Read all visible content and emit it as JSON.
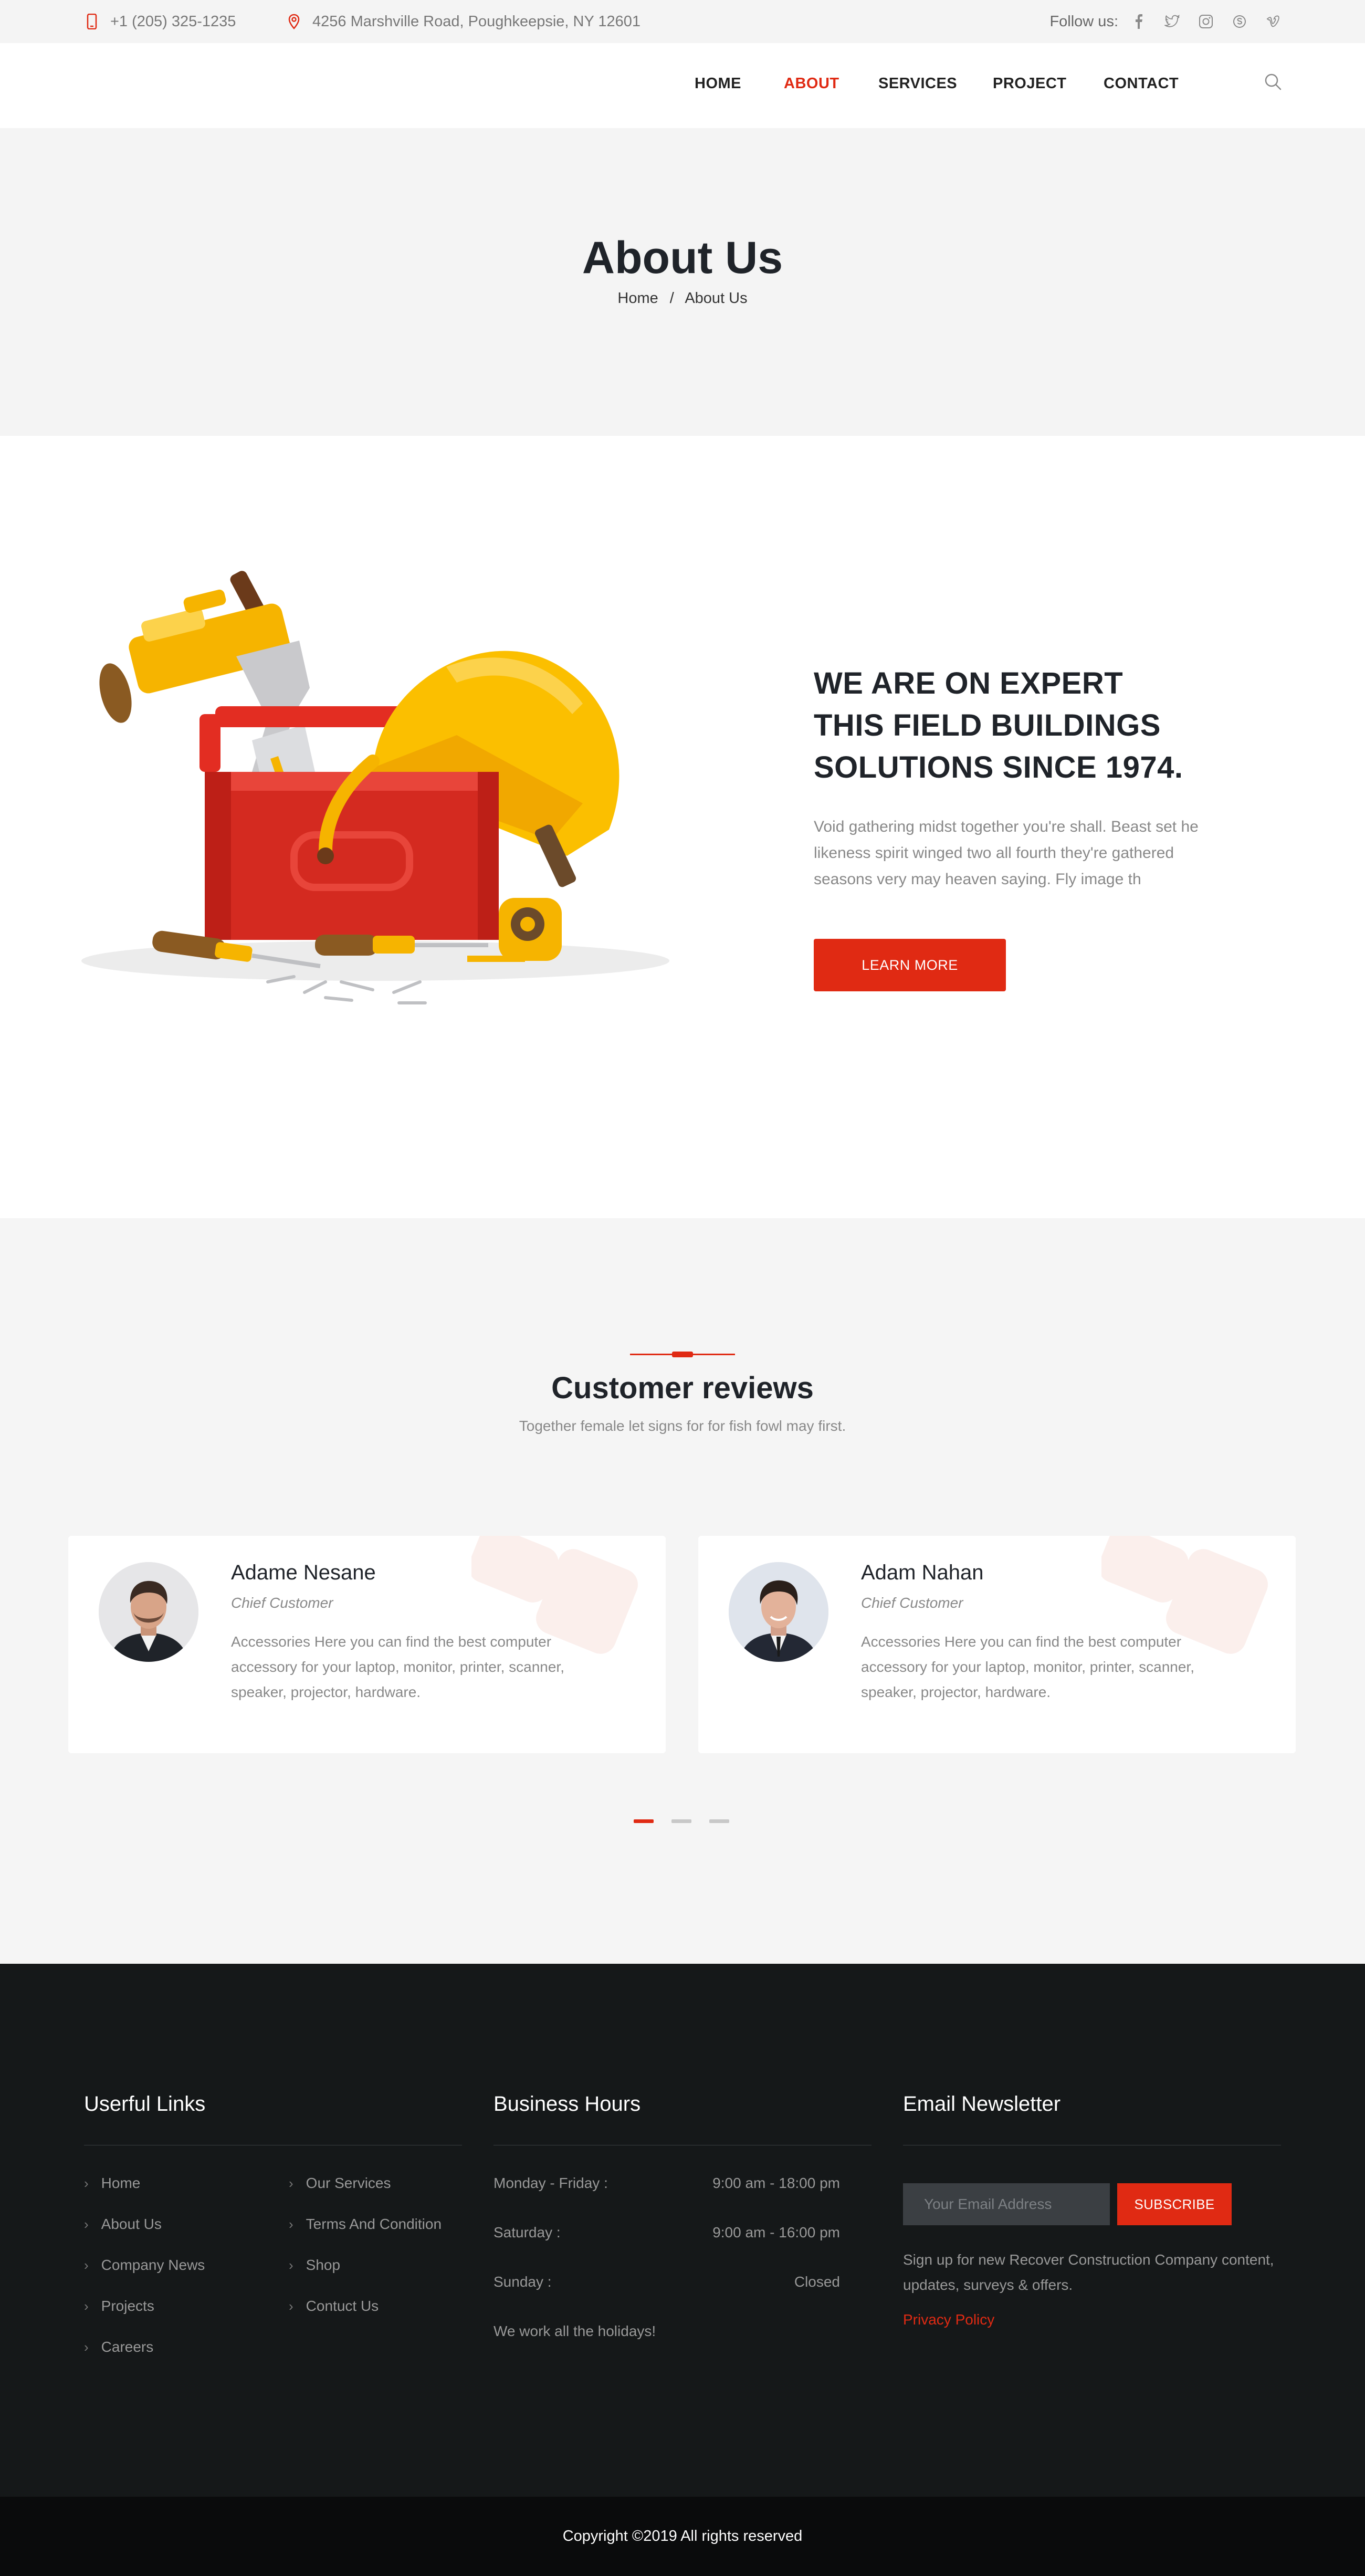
{
  "topbar": {
    "phone": "+1 (205) 325-1235",
    "address": "4256 Marshville Road, Poughkeepsie, NY 12601",
    "follow_label": "Follow us:",
    "social_icons": [
      "facebook-icon",
      "twitter-icon",
      "instagram-icon",
      "skype-icon",
      "vimeo-icon"
    ],
    "icons": {
      "phone": "mobile-phone-icon",
      "address": "map-pin-icon"
    }
  },
  "nav": {
    "items": [
      {
        "label": "HOME",
        "active": false
      },
      {
        "label": "ABOUT",
        "active": true
      },
      {
        "label": "SERVICES",
        "active": false
      },
      {
        "label": "PROJECT",
        "active": false
      },
      {
        "label": "CONTACT",
        "active": false
      }
    ],
    "search_icon": "search-icon"
  },
  "hero": {
    "title": "About Us",
    "breadcrumb": {
      "home": "Home",
      "separator": "/",
      "current": "About Us"
    }
  },
  "about": {
    "title_lines": [
      "WE ARE ON EXPERT",
      "THIS FIELD BUILDINGS",
      "SOLUTIONS SINCE 1974."
    ],
    "text": "Void gathering midst together you're shall. Beast set he likeness spirit winged two all fourth they're gathered seasons very may heaven saying. Fly image th",
    "button": "LEARN MORE"
  },
  "reviews": {
    "title": "Customer reviews",
    "subtitle": "Together female let signs for for fish fowl may first.",
    "cards": [
      {
        "name": "Adame Nesane",
        "role": "Chief Customer",
        "text": "Accessories Here you can find the best computer accessory for your laptop, monitor, printer, scanner, speaker, projector, hardware."
      },
      {
        "name": "Adam Nahan",
        "role": "Chief Customer",
        "text": "Accessories Here you can find the best computer accessory for your laptop, monitor, printer, scanner, speaker, projector, hardware."
      }
    ],
    "pager": {
      "count": 3,
      "active": 0
    }
  },
  "footer": {
    "links_title": "Userful Links",
    "links_col1": [
      "Home",
      "About Us",
      "Company News",
      "Projects",
      "Careers"
    ],
    "links_col2": [
      "Our Services",
      "Terms And Condition",
      "Shop",
      "Contuct Us"
    ],
    "hours_title": "Business Hours",
    "hours": [
      {
        "day": "Monday - Friday :",
        "time": "9:00 am - 18:00 pm"
      },
      {
        "day": "Saturday :",
        "time": "9:00 am - 16:00 pm"
      },
      {
        "day": "Sunday :",
        "time": "Closed"
      }
    ],
    "holidays": "We work all the holidays!",
    "newsletter_title": "Email Newsletter",
    "email_placeholder": "Your Email Address",
    "subscribe": "SUBSCRIBE",
    "newsletter_text": "Sign up for new Recover Construction Company content, updates, surveys & offers.",
    "privacy": "Privacy Policy"
  },
  "copyright": "Copyright ©2019 All rights reserved",
  "colors": {
    "accent": "#e02a13",
    "footer_bg": "#151819",
    "light_bg": "#f4f4f4"
  }
}
